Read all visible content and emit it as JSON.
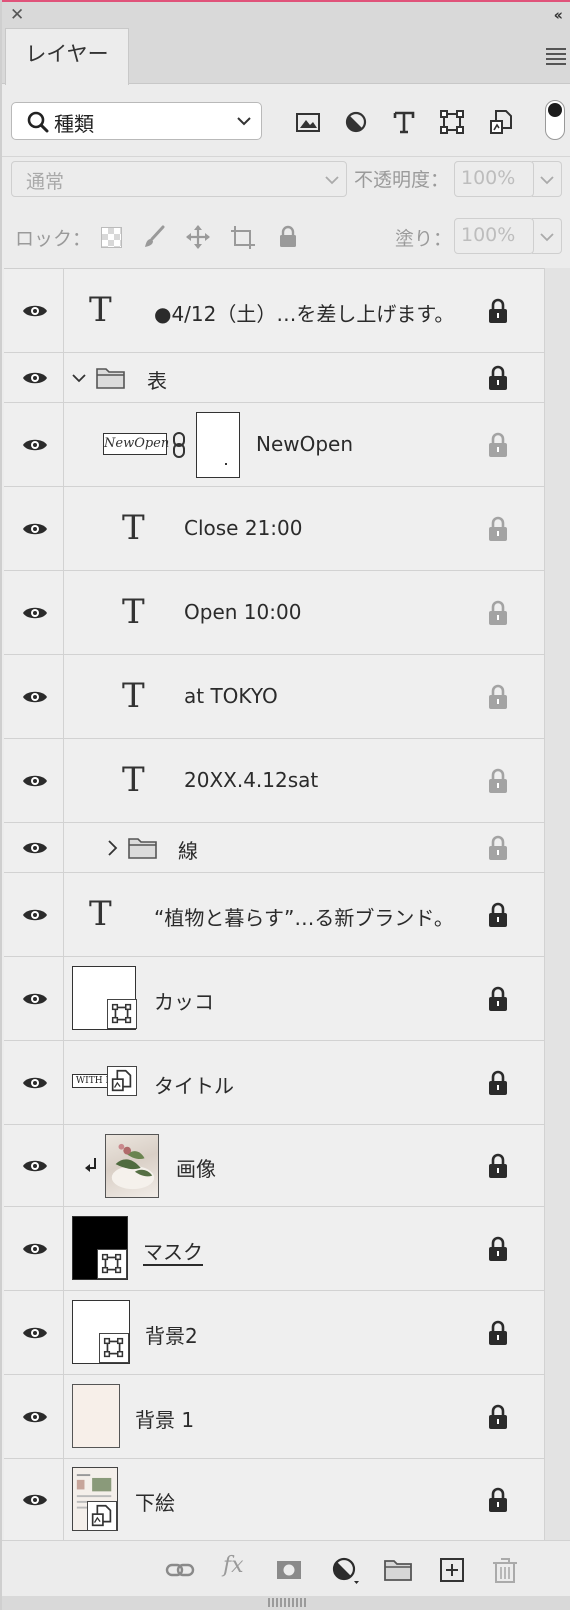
{
  "panel": {
    "tab_label": "レイヤー",
    "close_icon": "close-icon",
    "collapse_icon": "double-chevron-left-icon",
    "menu_icon": "panel-menu-icon"
  },
  "filter": {
    "kind_label": "種類",
    "icons": [
      "image-filter-icon",
      "adjustment-filter-icon",
      "type-filter-icon",
      "shape-filter-icon",
      "smart-object-filter-icon"
    ],
    "toggle": "filter-toggle"
  },
  "blend": {
    "mode": "通常",
    "opacity_label": "不透明度：",
    "opacity_value": "100%"
  },
  "lock": {
    "label": "ロック：",
    "fill_label": "塗り：",
    "fill_value": "100%"
  },
  "layers": [
    {
      "name": "●4/12（土）…を差し上げます。",
      "kind": "text",
      "lock": "dark"
    },
    {
      "name": "表",
      "kind": "group-open",
      "lock": "dark"
    },
    {
      "name": "NewOpen",
      "kind": "masked",
      "lock": "gray"
    },
    {
      "name": "Close 21:00",
      "kind": "text",
      "lock": "gray"
    },
    {
      "name": "Open 10:00",
      "kind": "text",
      "lock": "gray"
    },
    {
      "name": "at TOKYO",
      "kind": "text",
      "lock": "gray"
    },
    {
      "name": "20XX.4.12sat",
      "kind": "text",
      "lock": "gray"
    },
    {
      "name": "線",
      "kind": "group-closed",
      "lock": "gray"
    },
    {
      "name": "“植物と暮らす”…る新ブランド。",
      "kind": "text",
      "lock": "dark"
    },
    {
      "name": "カッコ",
      "kind": "shape",
      "lock": "dark"
    },
    {
      "name": "タイトル",
      "kind": "smart",
      "lock": "dark"
    },
    {
      "name": "画像",
      "kind": "image-clipped",
      "lock": "dark"
    },
    {
      "name": "マスク",
      "kind": "shape-black",
      "lock": "dark"
    },
    {
      "name": "背景2",
      "kind": "shape-white",
      "lock": "dark"
    },
    {
      "name": "背景 1",
      "kind": "fill",
      "lock": "dark"
    },
    {
      "name": "下絵",
      "kind": "smart-image",
      "lock": "dark"
    }
  ],
  "thumb_text": {
    "newopen": "NewOpen",
    "title": "WITH B"
  },
  "colors": {
    "lock_dark": "#2b2b2b",
    "lock_gray": "#a3a3a3",
    "bg1_fill": "#f7efe9",
    "accent_top": "#e0537a"
  },
  "bottom": {
    "icons": [
      "link-layers-icon",
      "fx-icon",
      "add-mask-icon",
      "adjustment-layer-icon",
      "new-group-icon",
      "new-layer-icon",
      "delete-icon"
    ],
    "fx_label": "fx"
  }
}
